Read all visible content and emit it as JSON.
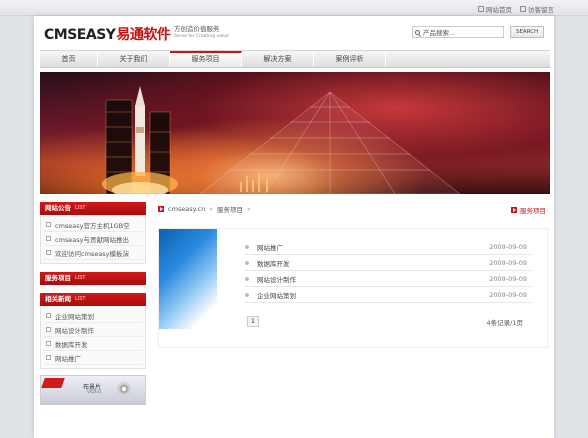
{
  "topbar": {
    "links": [
      {
        "label": "网站首页",
        "icon": "home-icon"
      },
      {
        "label": "访客留言",
        "icon": "guestbook-icon"
      }
    ]
  },
  "header": {
    "logo_latin": "CMSEASY",
    "logo_cn": "易通软件",
    "slogan_cn": "方创造价值服务",
    "slogan_en": "Serve for Creating value",
    "search_placeholder": "产品搜索...",
    "search_button": "SEARCH"
  },
  "nav": {
    "items": [
      "首页",
      "关于我们",
      "服务项目",
      "解决方案",
      "案例评析"
    ],
    "active_index": 2
  },
  "sidebar": {
    "notice": {
      "title": "网站公告",
      "title_en": "LIST",
      "items": [
        "cmseasy官方主机1GB空",
        "cmseasy与贡献网站推出",
        "欢迎访问cmseasy模板演"
      ]
    },
    "services": {
      "title": "服务项目",
      "title_en": "LIST"
    },
    "news": {
      "title": "相关新闻",
      "title_en": "LIST",
      "items": [
        "企业网站策划",
        "网站设计制作",
        "数据库开发",
        "网站推广"
      ]
    },
    "ad": {
      "title": "布景片",
      "subtitle": "VIDEO"
    }
  },
  "breadcrumb": {
    "home": "cmseasy.cn",
    "current": "服务项目",
    "section_title": "服务项目"
  },
  "articles": [
    {
      "title": "网站推广",
      "date": "2009-09-09"
    },
    {
      "title": "数据库开发",
      "date": "2009-09-09"
    },
    {
      "title": "网站设计制作",
      "date": "2009-09-09"
    },
    {
      "title": "企业网站策划",
      "date": "2009-09-09"
    }
  ],
  "pager": {
    "page": "1",
    "info": "4条记录/1页"
  },
  "colors": {
    "accent": "#c9161c",
    "page_bg": "#dfe2e6"
  }
}
